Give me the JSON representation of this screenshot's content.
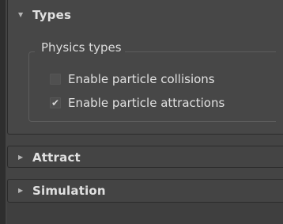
{
  "rollouts": {
    "types": {
      "title": "Types",
      "arrow": "▼",
      "group": {
        "label": "Physics types",
        "options": [
          {
            "label": "Enable particle collisions",
            "checked": false,
            "mark": ""
          },
          {
            "label": "Enable particle attractions",
            "checked": true,
            "mark": "✔"
          }
        ]
      }
    },
    "attract": {
      "title": "Attract",
      "arrow": "▶"
    },
    "simulation": {
      "title": "Simulation",
      "arrow": "▶"
    }
  },
  "colors": {
    "panel_bg": "#444444",
    "border": "#2b2b2b",
    "text": "#e2e2e2"
  }
}
